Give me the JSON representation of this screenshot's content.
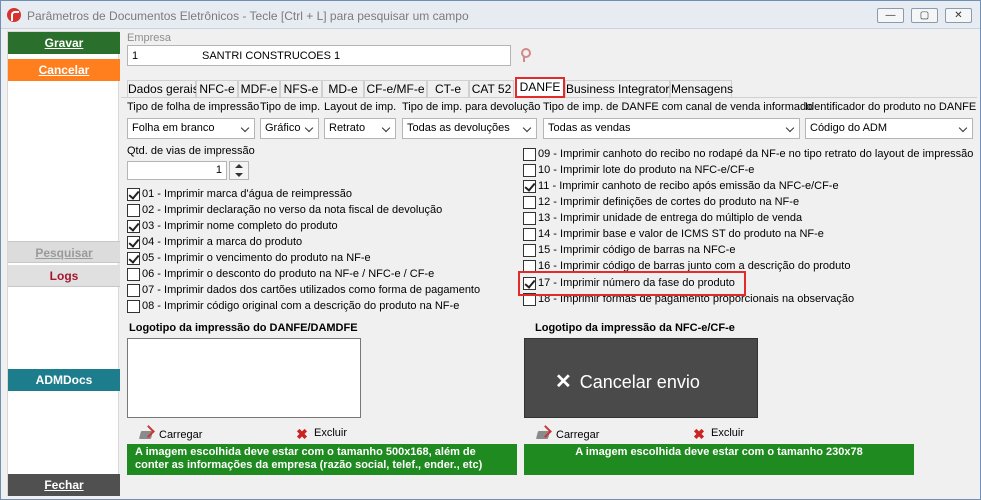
{
  "window": {
    "title": "Parâmetros de Documentos Eletrônicos - Tecle [Ctrl + L] para pesquisar um campo",
    "minimize": "—",
    "maximize": "▢",
    "close": "✕"
  },
  "sidebar": {
    "gravar": "Gravar",
    "cancelar": "Cancelar",
    "pesquisar": "Pesquisar",
    "logs": "Logs",
    "admdocs": "ADMDocs",
    "fechar": "Fechar"
  },
  "empresa": {
    "label": "Empresa",
    "code": "1",
    "name": "SANTRI CONSTRUCOES 1"
  },
  "tabs": [
    "Dados gerais",
    "NFC-e",
    "MDF-e",
    "NFS-e",
    "MD-e",
    "CF-e/MF-e",
    "CT-e",
    "CAT 52",
    "DANFE",
    "Business Integrator",
    "Mensagens"
  ],
  "active_tab": "DANFE",
  "fields": {
    "tipo_folha": {
      "label": "Tipo de folha de impressão",
      "value": "Folha em branco"
    },
    "tipo_imp": {
      "label": "Tipo de imp.",
      "value": "Gráfico"
    },
    "layout_imp": {
      "label": "Layout de imp.",
      "value": "Retrato"
    },
    "tipo_devolucao": {
      "label": "Tipo de imp. para devolução",
      "value": "Todas as devoluções"
    },
    "tipo_canal": {
      "label": "Tipo de imp. de DANFE com canal de venda informado",
      "value": "Todas as vendas"
    },
    "identificador": {
      "label": "Identificador do produto no DANFE",
      "value": "Código do ADM"
    },
    "qtd_vias": {
      "label": "Qtd. de vias de impressão",
      "value": "1"
    }
  },
  "options_left": [
    {
      "label": "01 - Imprimir marca d'água de reimpressão",
      "checked": true
    },
    {
      "label": "02 - Imprimir declaração no verso da nota fiscal de devolução",
      "checked": false
    },
    {
      "label": "03 - Imprimir nome completo do produto",
      "checked": true
    },
    {
      "label": "04 - Imprimir a marca do produto",
      "checked": true
    },
    {
      "label": "05 - Imprimir o vencimento do produto na NF-e",
      "checked": true
    },
    {
      "label": "06 - Imprimir o desconto do produto na NF-e / NFC-e / CF-e",
      "checked": false
    },
    {
      "label": "07 - Imprimir dados dos cartões utilizados como forma de pagamento",
      "checked": false
    },
    {
      "label": "08 - Imprimir código original com a descrição do produto na NF-e",
      "checked": false
    }
  ],
  "options_right": [
    {
      "label": "09 - Imprimir canhoto do recibo no rodapé da NF-e no tipo retrato do layout de impressão",
      "checked": false
    },
    {
      "label": "10 - Imprimir lote do produto na NFC-e/CF-e",
      "checked": false
    },
    {
      "label": "11 - Imprimir canhoto de recibo após emissão da NFC-e/CF-e",
      "checked": true
    },
    {
      "label": "12 - Imprimir definições de cortes do produto na NF-e",
      "checked": false
    },
    {
      "label": "13 - Imprimir unidade de entrega do múltiplo de venda",
      "checked": false
    },
    {
      "label": "14 - Imprimir base e valor de ICMS ST do produto na NF-e",
      "checked": false
    },
    {
      "label": "15 - Imprimir código de barras na NFC-e",
      "checked": false
    },
    {
      "label": "16 - Imprimir código de barras junto com a descrição do produto",
      "checked": false
    },
    {
      "label": "17 - Imprimir número da fase do produto",
      "checked": true
    },
    {
      "label": "18 - Imprimir formas de pagamento proporcionais na observação",
      "checked": false
    }
  ],
  "logo_danfe": {
    "title": "Logotipo da impressão do DANFE/DAMDFE",
    "carregar": "Carregar",
    "excluir": "Excluir",
    "info": "A imagem escolhida deve estar com o tamanho 500x168, além de conter as informações da empresa (razão social, telef., ender., etc)"
  },
  "logo_nfce": {
    "title": "Logotipo da impressão da NFC-e/CF-e",
    "preview_icon": "✕",
    "preview_text": "Cancelar envio",
    "carregar": "Carregar",
    "excluir": "Excluir",
    "info": "A imagem escolhida deve estar com o tamanho 230x78"
  },
  "colors": {
    "gravar": "#2a6f2c",
    "cancelar": "#ff7f1f",
    "admdocs": "#1e7d8c",
    "fechar": "#505050",
    "info_green": "#1f8a1f",
    "highlight_red": "#e22b2b"
  },
  "icons": [
    "app-logo-icon",
    "key-icon",
    "chevron-down-icon",
    "load-icon",
    "delete-icon"
  ]
}
